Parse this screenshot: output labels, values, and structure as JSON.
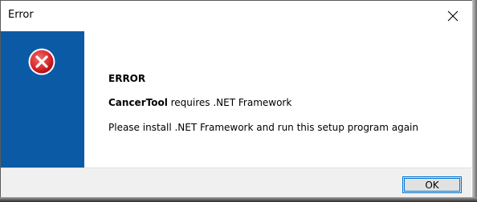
{
  "window": {
    "title": "Error",
    "close_icon": "close-icon"
  },
  "sidebar": {
    "icon": "error-icon",
    "accent_color": "#0b5aa6",
    "icon_color": "#d9262b"
  },
  "message": {
    "heading": "ERROR",
    "app_name": "CancerTool",
    "requirement_text": " requires .NET Framework",
    "instruction_text": "Please install .NET Framework and run this setup program again"
  },
  "buttons": {
    "ok_label": "OK"
  }
}
